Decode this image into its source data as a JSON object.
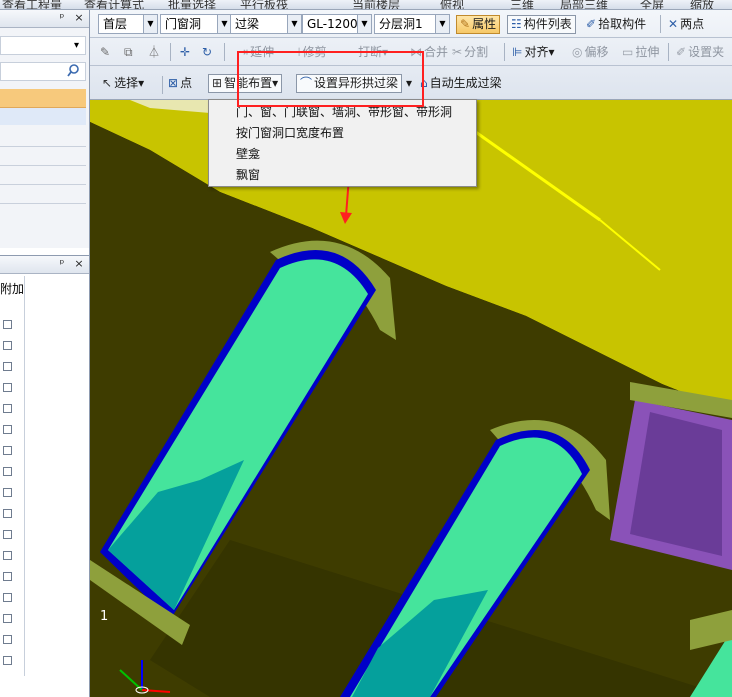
{
  "topbar": {
    "items": [
      "查看工程量",
      "查看计算式",
      "批量选择",
      "平行板筏",
      "当前楼层",
      "俯视",
      "三维",
      "局部三维",
      "全屏",
      "缩放"
    ]
  },
  "panel_top": {
    "pin": "ᵖ",
    "close": "×",
    "combo_arrow": "▾",
    "search_icon": "search-icon"
  },
  "panel_bottom": {
    "pin": "ᵖ",
    "close": "×",
    "header_fragment": "附加"
  },
  "toolbar1": {
    "floor": "首层",
    "category": "门窗洞",
    "member": "过梁",
    "component": "GL-1200",
    "layer": "分层洞1",
    "properties": "属性",
    "component_list": "构件列表",
    "pick_component": "拾取构件",
    "two_points": "两点"
  },
  "toolbar2": {
    "extend": "延伸",
    "trim": "修剪",
    "break": "打断",
    "merge": "合并",
    "split": "分割",
    "align": "对齐",
    "offset": "偏移",
    "stretch": "拉伸",
    "set_clip": "设置夹"
  },
  "toolbar3": {
    "select": "选择",
    "point": "点",
    "smart_layout": "智能布置",
    "set_arch_lintel": "设置异形拱过梁",
    "auto_generate_lintel": "自动生成过梁"
  },
  "dropdown": {
    "items": [
      "门、窗、门联窗、墙洞、带形窗、带形洞",
      "按门窗洞口宽度布置",
      "壁龛",
      "飘窗"
    ]
  },
  "viewport": {
    "corner_label": "1"
  },
  "colors": {
    "annotation": "#ff2020",
    "wall_top": "#c8c400",
    "wall_face": "#3e3c00",
    "opening_fill": "#45e49c",
    "opening_border": "#0000c8",
    "lintel": "#8ea03c",
    "highlight": "#ffff00",
    "purple": "#8a52b8"
  }
}
